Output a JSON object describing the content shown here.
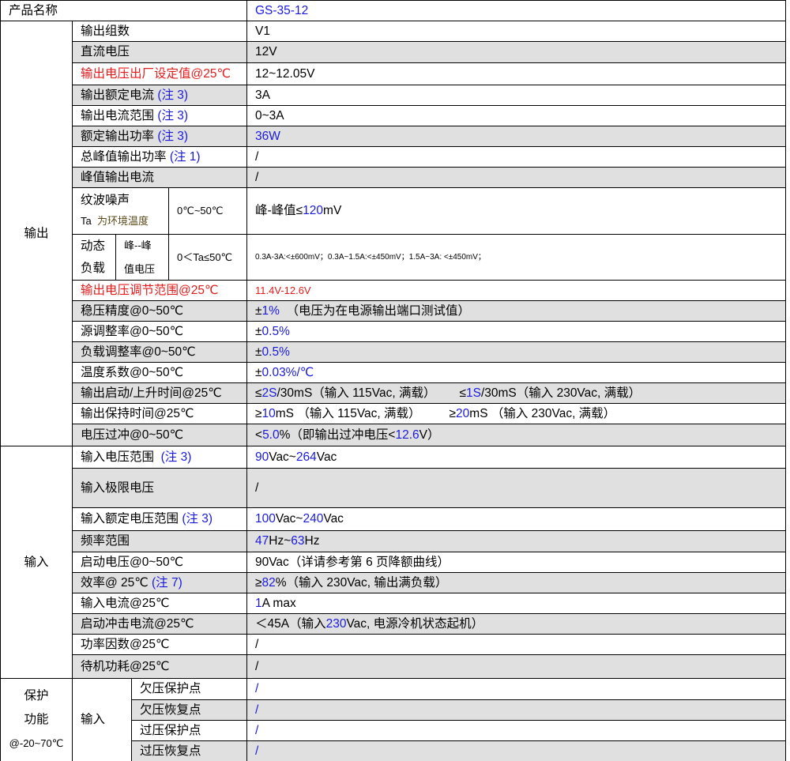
{
  "header": {
    "label": "产品名称",
    "value": "GS-35-12"
  },
  "output": {
    "group_label": "输出",
    "rows": [
      {
        "label": "输出组数",
        "value": "V1"
      },
      {
        "label": "直流电压",
        "value": "12V"
      },
      {
        "label": "输出电压出厂设定值@25℃",
        "value": "12~12.05V"
      },
      {
        "label": "输出额定电流",
        "note": "(注 3)",
        "value": "3A"
      },
      {
        "label": "输出电流范围",
        "note": "(注 3)",
        "value": "0~3A"
      },
      {
        "label": "额定输出功率",
        "note": "(注 3)",
        "value": "36W"
      },
      {
        "label": "总峰值输出功率",
        "note": "(注 1)",
        "value": "/"
      },
      {
        "label": "峰值输出电流",
        "value": "/"
      }
    ],
    "ripple": {
      "label": "纹波噪声",
      "ta_prefix": "Ta",
      "ta_desc": "为环境温度",
      "temp": "0℃~50℃",
      "value_prefix": "峰-峰值≤",
      "value_num": "120",
      "value_unit": "mV"
    },
    "dynamic": {
      "label_a": "动态",
      "label_b": "负载",
      "sub_a": "峰--峰",
      "sub_b": "值电压",
      "temp": "0＜Ta≤50℃",
      "value": "0.3A-3A:<±600mV；0.3A~1.5A:<±450mV；1.5A~3A: <±450mV；"
    },
    "rows2": [
      {
        "label": "输出电压调节范围@25℃",
        "value": "11.4V-12.6V"
      },
      {
        "label": "稳压精度@0~50℃",
        "v1": "±",
        "v2": "1%",
        "v3": "（电压为在电源输出端口测试值）"
      },
      {
        "label": "源调整率@0~50℃",
        "v1": "±",
        "v2": "0.5%"
      },
      {
        "label": "负载调整率@0~50℃",
        "v1": "±",
        "v2": "0.5%"
      },
      {
        "label": "温度系数@0~50℃",
        "v1": "±",
        "v2": "0.03%/℃"
      },
      {
        "label": "输出启动/上升时间@25℃",
        "v1": "≤",
        "v2": "2S",
        "v3": "/30mS（输入 115Vac,  满载）",
        "v4": "≤",
        "v5": "1S",
        "v6": "/30mS（输入 230Vac, 满载）"
      },
      {
        "label": "输出保持时间@25℃",
        "v1": "≥",
        "v2": "10",
        "v3": "mS  （输入 115Vac,  满载）",
        "v4": "≥",
        "v5": "20",
        "v6": "mS  （输入 230Vac, 满载）"
      },
      {
        "label": "电压过冲@0~50℃",
        "v1": "<",
        "v2": "5.0",
        "v3": "%（即输出过冲电压<",
        "v4": "12.6",
        "v5": "V）"
      }
    ]
  },
  "input": {
    "group_label": "输入",
    "rows": [
      {
        "label": "输入电压范围",
        "note": "(注 3)",
        "v1": "90",
        "v2": "Vac~",
        "v3": "264",
        "v4": "Vac"
      },
      {
        "label": "输入极限电压",
        "value": "/"
      },
      {
        "label": "输入额定电压范围",
        "note": "(注 3)",
        "v1": "100",
        "v2": "Vac~",
        "v3": "240",
        "v4": "Vac"
      },
      {
        "label": "频率范围",
        "v1": "47",
        "v2": "Hz~",
        "v3": "63",
        "v4": "Hz"
      },
      {
        "label": "启动电压@0~50℃",
        "value": "90Vac（详请参考第 6 页降额曲线）"
      },
      {
        "label": "效率@ 25℃",
        "note": "(注 7)",
        "v1": "≥",
        "v2": "82",
        "v3": "%（输入 230Vac, 输出满负载）"
      },
      {
        "label": "输入电流@25℃",
        "v1": "1",
        "v2": " A max"
      },
      {
        "label": "启动冲击电流@25℃",
        "v1": "＜45A（输入 ",
        "v2": "230",
        "v3": "Vac, 电源冷机状态起机）"
      },
      {
        "label": "功率因数@25℃",
        "value": "/"
      },
      {
        "label": "待机功耗@25℃",
        "value": "/"
      }
    ]
  },
  "protection": {
    "label_a": "保护",
    "label_b": "功能",
    "label_c": "@-20~70℃",
    "sub_group": "输入",
    "rows": [
      {
        "label": "欠压保护点",
        "value": "/"
      },
      {
        "label": "欠压恢复点",
        "value": "/"
      },
      {
        "label": "过压保护点",
        "value": "/"
      },
      {
        "label": "过压恢复点",
        "value": "/"
      }
    ]
  }
}
